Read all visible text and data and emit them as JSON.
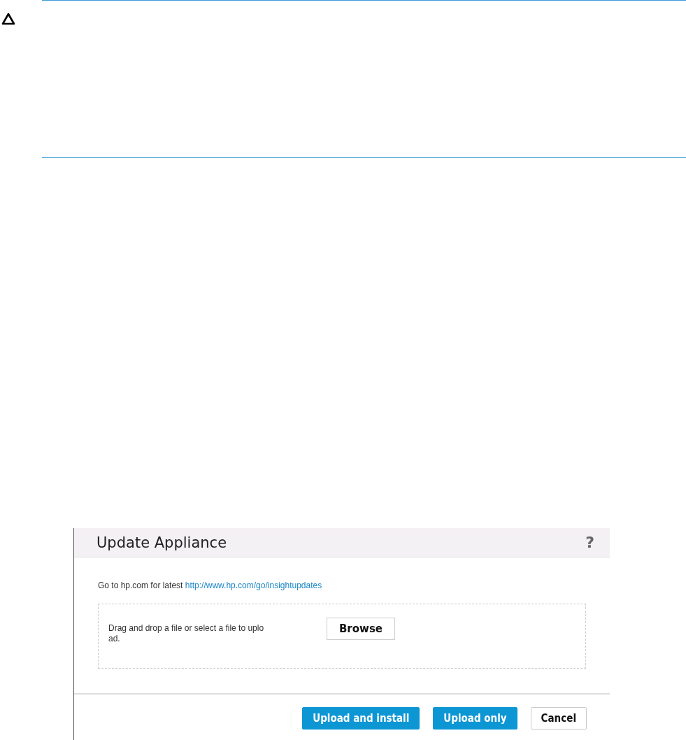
{
  "caution": {
    "kind": "caution"
  },
  "dialog": {
    "title": "Update Appliance",
    "help": "?",
    "intro": "Go to hp.com for latest",
    "link": "http://www.hp.com/go/insightupdates",
    "drop_zone": {
      "text": "Drag and drop a file or select a file to uplo",
      "text_wrap": "ad.",
      "button": "Browse"
    },
    "buttons": [
      {
        "label": "Upload and install",
        "kind": "primary"
      },
      {
        "label": "Upload only",
        "kind": "primary"
      },
      {
        "label": "Cancel",
        "kind": "secondary"
      }
    ]
  }
}
